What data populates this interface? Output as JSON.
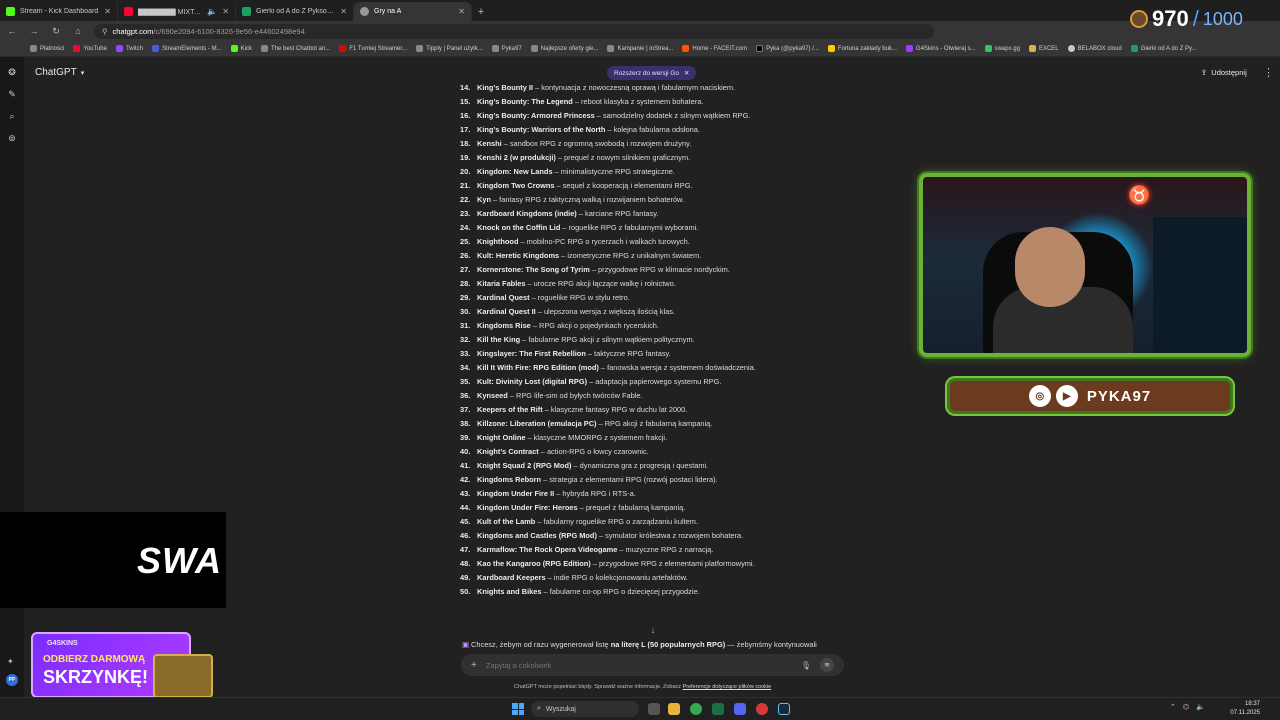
{
  "browser": {
    "tabs": [
      {
        "title": "Stream - Kick Dashboard",
        "color": "#53fc18"
      },
      {
        "title": "▇▇▇▇▇▇▇ MIXTAPE",
        "color": "#ff0033"
      },
      {
        "title": "Gierki od A do Z Pykson - Arku...",
        "color": "#1aa260"
      },
      {
        "title": "Gry na A",
        "color": "#888888"
      }
    ],
    "url_host": "chatgpt.com",
    "url_path": "/c/690e2094-6100-8326-9e56-e44602498e94",
    "bookmarks": [
      "Płatności",
      "YouTube",
      "Twitch",
      "StreamElements - M...",
      "Kick",
      "The best Chatbot an...",
      "F1 Turniej Streamer...",
      "Tipply | Panel użytk...",
      "Pyka97",
      "Najlepsze oferty gie...",
      "Kampanie | inStrea...",
      "Home - FACEIT.com",
      "Pyka (@pyka97) /...",
      "Fortuna zakłady buk...",
      "G4Skins - Otwieraj s...",
      "swapx.gg",
      "EXCEL",
      "BELABOX cloud",
      "Gierki od A do Z Py..."
    ]
  },
  "app": {
    "title": "ChatGPT",
    "upgrade_pill": "Rozszerz do wersji Go",
    "share_label": "Udostępnij",
    "composer_placeholder": "Zapytaj o cokolwiek",
    "disclaimer_prefix": "ChatGPT może popełniać błędy. Sprawdź ważne informacje. Zobacz",
    "disclaimer_link": "Preferencje dotyczące plików cookie",
    "user_initials": "PP"
  },
  "games": [
    {
      "num": "14.",
      "name": "King’s Bounty II",
      "desc": " – kontynuacja z nowoczesną oprawą i fabularnym naciskiem."
    },
    {
      "num": "15.",
      "name": "King’s Bounty: The Legend",
      "desc": " – reboot klasyka z systemem bohatera."
    },
    {
      "num": "16.",
      "name": "King’s Bounty: Armored Princess",
      "desc": " – samodzielny dodatek z silnym wątkiem RPG."
    },
    {
      "num": "17.",
      "name": "King’s Bounty: Warriors of the North",
      "desc": " – kolejna fabularna odsłona."
    },
    {
      "num": "18.",
      "name": "Kenshi",
      "desc": " – sandbox RPG z ogromną swobodą i rozwojem drużyny."
    },
    {
      "num": "19.",
      "name": "Kenshi 2 (w produkcji)",
      "desc": " – prequel z nowym silnikiem graficznym."
    },
    {
      "num": "20.",
      "name": "Kingdom: New Lands",
      "desc": " – minimalistyczne RPG strategiczne."
    },
    {
      "num": "21.",
      "name": "Kingdom Two Crowns",
      "desc": " – sequel z kooperacją i elementami RPG."
    },
    {
      "num": "22.",
      "name": "Kyn",
      "desc": " – fantasy RPG z taktyczną walką i rozwijaniem bohaterów."
    },
    {
      "num": "23.",
      "name": "Kardboard Kingdoms (indie)",
      "desc": " – karciane RPG fantasy."
    },
    {
      "num": "24.",
      "name": "Knock on the Coffin Lid",
      "desc": " – roguelike RPG z fabularnymi wyborami."
    },
    {
      "num": "25.",
      "name": "Knighthood",
      "desc": " – mobilno-PC RPG o rycerzach i walkach turowych."
    },
    {
      "num": "26.",
      "name": "Kult: Heretic Kingdoms",
      "desc": " – izometryczne RPG z unikalnym światem."
    },
    {
      "num": "27.",
      "name": "Kornerstone: The Song of Tyrim",
      "desc": " – przygodowe RPG w klimacie nordyckim."
    },
    {
      "num": "28.",
      "name": "Kitaria Fables",
      "desc": " – urocze RPG akcji łączące walkę i rolnictwo."
    },
    {
      "num": "29.",
      "name": "Kardinal Quest",
      "desc": " – roguelike RPG w stylu retro."
    },
    {
      "num": "30.",
      "name": "Kardinal Quest II",
      "desc": " – ulepszona wersja z większą ilością klas."
    },
    {
      "num": "31.",
      "name": "Kingdoms Rise",
      "desc": " – RPG akcji o pojedynkach rycerskich."
    },
    {
      "num": "32.",
      "name": "Kill the King",
      "desc": " – fabularne RPG akcji z silnym wątkiem politycznym."
    },
    {
      "num": "33.",
      "name": "Kingslayer: The First Rebellion",
      "desc": " – taktyczne RPG fantasy."
    },
    {
      "num": "34.",
      "name": "Kill It With Fire: RPG Edition (mod)",
      "desc": " – fanowska wersja z systemem doświadczenia."
    },
    {
      "num": "35.",
      "name": "Kult: Divinity Lost (digital RPG)",
      "desc": " – adaptacja papierowego systemu RPG."
    },
    {
      "num": "36.",
      "name": "Kynseed",
      "desc": " – RPG life-sim od byłych twórców Fable."
    },
    {
      "num": "37.",
      "name": "Keepers of the Rift",
      "desc": " – klasyczne fantasy RPG w duchu lat 2000."
    },
    {
      "num": "38.",
      "name": "Killzone: Liberation (emulacja PC)",
      "desc": " – RPG akcji z fabularną kampanią."
    },
    {
      "num": "39.",
      "name": "Knight Online",
      "desc": " – klasyczne MMORPG z systemem frakcji."
    },
    {
      "num": "40.",
      "name": "Knight’s Contract",
      "desc": " – action-RPG o łowcy czarownic."
    },
    {
      "num": "41.",
      "name": "Knight Squad 2 (RPG Mod)",
      "desc": " – dynamiczna gra z progresją i questami."
    },
    {
      "num": "42.",
      "name": "Kingdoms Reborn",
      "desc": " – strategia z elementami RPG (rozwój postaci lidera)."
    },
    {
      "num": "43.",
      "name": "Kingdom Under Fire II",
      "desc": " – hybryda RPG i RTS-a."
    },
    {
      "num": "44.",
      "name": "Kingdom Under Fire: Heroes",
      "desc": " – prequel z fabularną kampanią."
    },
    {
      "num": "45.",
      "name": "Kult of the Lamb",
      "desc": " – fabularny roguelike RPG o zarządzaniu kultem."
    },
    {
      "num": "46.",
      "name": "Kingdoms and Castles (RPG Mod)",
      "desc": " – symulator królestwa z rozwojem bohatera."
    },
    {
      "num": "47.",
      "name": "Karmaflow: The Rock Opera Videogame",
      "desc": " – muzyczne RPG z narracją."
    },
    {
      "num": "48.",
      "name": "Kao the Kangaroo (RPG Edition)",
      "desc": " – przygodowe RPG z elementami platformowymi."
    },
    {
      "num": "49.",
      "name": "Kardboard Keepers",
      "desc": " – indie RPG o kolekcjonowaniu artefaktów."
    },
    {
      "num": "50.",
      "name": "Knights and Bikes",
      "desc": " – fabularne co-op RPG o dziecięcej przygodzie."
    }
  ],
  "preview": {
    "prefix": "Chcesz, żebym od razu wygenerował listę ",
    "bold": "na literę L (50 popularnych RPG)",
    "suffix": " — żebymśmy kontynuowali"
  },
  "stream": {
    "counter_current": "970",
    "counter_sep": "/",
    "counter_max": "1000",
    "social_handle": "PYKA97",
    "swap_text": "SWA",
    "promo_brand": "G4SKINS",
    "promo_line1": "ODBIERZ DARMOWĄ",
    "promo_line2": "SKRZYNKĘ!"
  },
  "taskbar": {
    "search_label": "Wyszukaj",
    "time": "18:37",
    "date": "07.11.2025"
  }
}
